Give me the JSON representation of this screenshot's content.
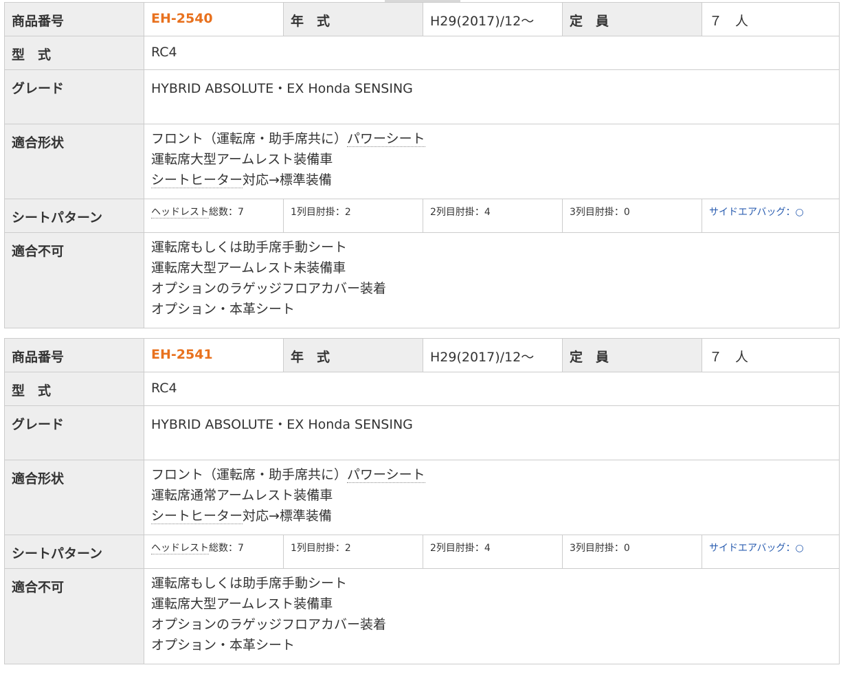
{
  "labels": {
    "product_no": "商品番号",
    "year": "年　式",
    "capacity": "定　員",
    "model": "型　式",
    "grade": "グレード",
    "fit_shape": "適合形状",
    "seat_pattern": "シートパターン",
    "not_fit": "適合不可"
  },
  "products": [
    {
      "code": "EH-2540",
      "year": "H29(2017)/12～",
      "capacity": "７　人",
      "model": "RC4",
      "grade": "HYBRID ABSOLUTE・EX Honda SENSING",
      "fit_shape": {
        "line1_prefix": "フロント（運転席・助手席共に）",
        "line1_link": "パワーシート",
        "line2": "運転席大型アームレスト装備車",
        "line3_link": "シートヒーター",
        "line3_suffix": "対応→標準装備"
      },
      "pattern": {
        "headrest_label": "ヘッドレスト",
        "headrest_value": "総数：7",
        "row1": "1列目肘掛：2",
        "row2": "2列目肘掛：4",
        "row3": "3列目肘掛：0",
        "airbag": "サイドエアバッグ：○"
      },
      "not_fit": [
        "運転席もしくは助手席手動シート",
        "運転席大型アームレスト未装備車",
        "オプションのラゲッジフロアカバー装着",
        "オプション・本革シート"
      ]
    },
    {
      "code": "EH-2541",
      "year": "H29(2017)/12～",
      "capacity": "７　人",
      "model": "RC4",
      "grade": "HYBRID ABSOLUTE・EX Honda SENSING",
      "fit_shape": {
        "line1_prefix": "フロント（運転席・助手席共に）",
        "line1_link": "パワーシート",
        "line2": "運転席通常アームレスト装備車",
        "line3_link": "シートヒーター",
        "line3_suffix": "対応→標準装備"
      },
      "pattern": {
        "headrest_label": "ヘッドレスト",
        "headrest_value": "総数：7",
        "row1": "1列目肘掛：2",
        "row2": "2列目肘掛：4",
        "row3": "3列目肘掛：0",
        "airbag": "サイドエアバッグ：○"
      },
      "not_fit": [
        "運転席もしくは助手席手動シート",
        "運転席大型アームレスト装備車",
        "オプションのラゲッジフロアカバー装着",
        "オプション・本革シート"
      ]
    }
  ],
  "colors": {
    "code": "#e8711e",
    "link": "#2a5db0",
    "header_bg": "#eeeeee",
    "border": "#cccccc"
  }
}
